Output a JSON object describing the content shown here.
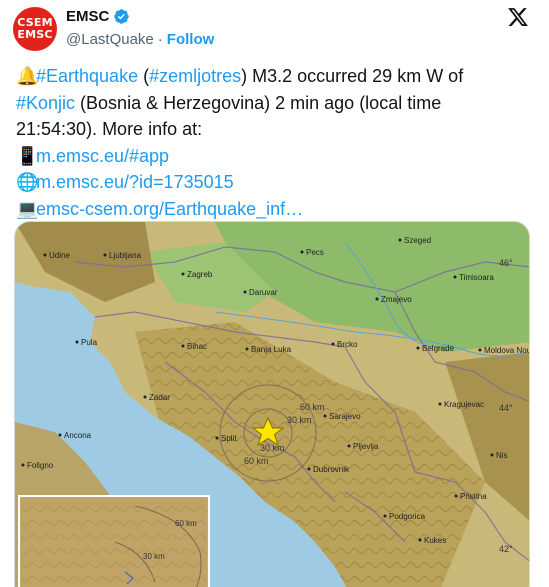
{
  "account": {
    "avatar_line1": "CSEM",
    "avatar_line2": "EMSC",
    "name": "EMSC",
    "handle": "@LastQuake",
    "separator": "·",
    "follow_label": "Follow"
  },
  "tweet": {
    "hashtag_earthquake": "#Earthquake",
    "open_paren": "(",
    "hashtag_zemljotres": "#zemljotres",
    "after_zemljotres": ") M3.2 occurred 29 km W of",
    "hashtag_konjic": "#Konjic",
    "after_konjic": " (Bosnia & Herzegovina) 2 min ago (local time",
    "line3": "21:54:30). More info at:",
    "link_app": "m.emsc.eu/#app",
    "link_id": "m.emsc.eu/?id=1735015",
    "link_full": "emsc-csem.org/Earthquake_inf…"
  },
  "map": {
    "cities": [
      "Udine",
      "Ljubljana",
      "Zagreb",
      "Pecs",
      "Szeged",
      "Timisoara",
      "Daruvar",
      "Zmajevo",
      "Pula",
      "Bihac",
      "Banja Luka",
      "Brcko",
      "Belgrade",
      "Moldova Noua",
      "Zadar",
      "Sarajevo",
      "Kragujevac",
      "Ancona",
      "Split",
      "Pljevlja",
      "Nis",
      "Foligno",
      "Dubrovnik",
      "Pristina",
      "Podgorica",
      "Kukes"
    ],
    "rings": [
      "60 km",
      "30 km",
      "60 km",
      "30 km"
    ],
    "inset_rings": [
      "60 km",
      "30 km"
    ],
    "lat_labels": [
      "46°",
      "44°",
      "42°"
    ],
    "accent_color": "#1d9bf0",
    "epicenter_color": "#ffe600"
  }
}
